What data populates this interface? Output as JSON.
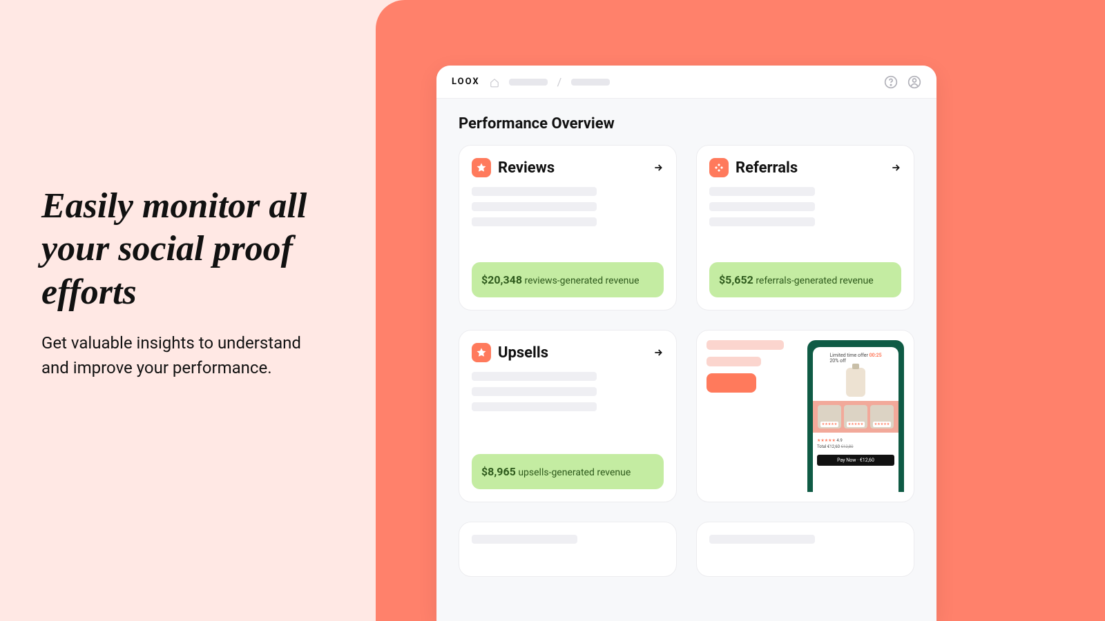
{
  "hero": {
    "headline": "Easily monitor all your social proof efforts",
    "subhead": "Get valuable insights to understand and improve your performance."
  },
  "app": {
    "brand": "LOOX",
    "page_title": "Performance Overview",
    "cards": {
      "reviews": {
        "title": "Reviews",
        "revenue_amount": "$20,348",
        "revenue_label": " reviews-generated revenue"
      },
      "referrals": {
        "title": "Referrals",
        "revenue_amount": "$5,652",
        "revenue_label": " referrals-generated revenue"
      },
      "upsells": {
        "title": "Upsells",
        "revenue_amount": "$8,965",
        "revenue_label": " upsells-generated revenue"
      }
    },
    "promo": {
      "offer_text": "Limited time offer",
      "offer_time": "00:25",
      "offer_discount": "20% off",
      "rating": "4.9",
      "total_label": "Total",
      "total_value": "€12,60",
      "old_value": "€12,80",
      "pay_button": "Pay Now · €12,60"
    }
  }
}
